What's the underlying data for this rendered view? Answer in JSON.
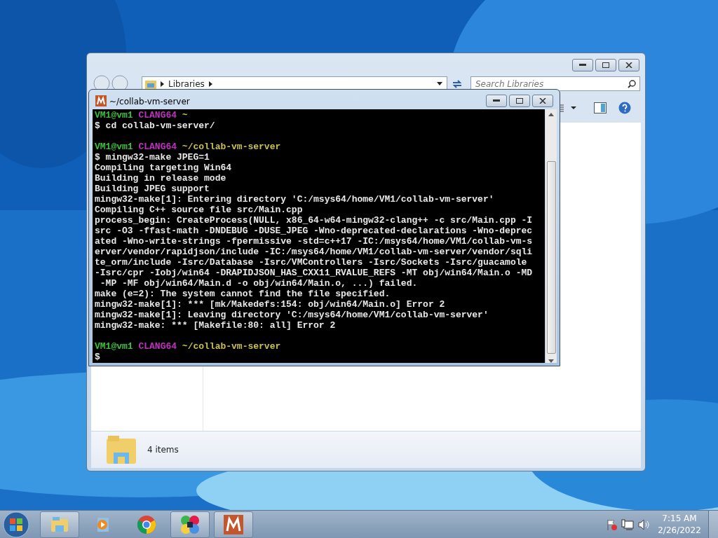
{
  "explorer": {
    "address": [
      "Libraries"
    ],
    "search": {
      "placeholder": "Search Libraries"
    },
    "status": "4 items"
  },
  "terminal": {
    "title": "~/collab-vm-server",
    "lines": [
      {
        "kind": "prompt",
        "user": "VM1@vm1",
        "env": "CLANG64",
        "path": "~"
      },
      {
        "kind": "text",
        "text": "$ cd collab-vm-server/"
      },
      {
        "kind": "blank"
      },
      {
        "kind": "prompt",
        "user": "VM1@vm1",
        "env": "CLANG64",
        "path": "~/collab-vm-server"
      },
      {
        "kind": "text",
        "text": "$ mingw32-make JPEG=1"
      },
      {
        "kind": "text",
        "text": "Compiling targeting Win64"
      },
      {
        "kind": "text",
        "text": "Building in release mode"
      },
      {
        "kind": "text",
        "text": "Building JPEG support"
      },
      {
        "kind": "text",
        "text": "mingw32-make[1]: Entering directory 'C:/msys64/home/VM1/collab-vm-server'"
      },
      {
        "kind": "text",
        "text": "Compiling C++ source file src/Main.cpp"
      },
      {
        "kind": "text",
        "text": "process_begin: CreateProcess(NULL, x86_64-w64-mingw32-clang++ -c src/Main.cpp -I"
      },
      {
        "kind": "text",
        "text": "src -O3 -ffast-math -DNDEBUG -DUSE_JPEG -Wno-deprecated-declarations -Wno-deprec"
      },
      {
        "kind": "text",
        "text": "ated -Wno-write-strings -fpermissive -std=c++17 -IC:/msys64/home/VM1/collab-vm-s"
      },
      {
        "kind": "text",
        "text": "erver/vendor/rapidjson/include -IC:/msys64/home/VM1/collab-vm-server/vendor/sqli"
      },
      {
        "kind": "text",
        "text": "te_orm/include -Isrc/Database -Isrc/VMControllers -Isrc/Sockets -Isrc/guacamole"
      },
      {
        "kind": "text",
        "text": "-Isrc/cpr -Iobj/win64 -DRAPIDJSON_HAS_CXX11_RVALUE_REFS -MT obj/win64/Main.o -MD"
      },
      {
        "kind": "text",
        "text": " -MP -MF obj/win64/Main.d -o obj/win64/Main.o, ...) failed."
      },
      {
        "kind": "text",
        "text": "make (e=2): The system cannot find the file specified."
      },
      {
        "kind": "text",
        "text": "mingw32-make[1]: *** [mk/Makedefs:154: obj/win64/Main.o] Error 2"
      },
      {
        "kind": "text",
        "text": "mingw32-make[1]: Leaving directory 'C:/msys64/home/VM1/collab-vm-server'"
      },
      {
        "kind": "text",
        "text": "mingw32-make: *** [Makefile:80: all] Error 2"
      },
      {
        "kind": "blank"
      },
      {
        "kind": "prompt",
        "user": "VM1@vm1",
        "env": "CLANG64",
        "path": "~/collab-vm-server"
      },
      {
        "kind": "text",
        "text": "$"
      }
    ]
  },
  "taskbar": {
    "items": [
      {
        "kind": "explorer",
        "open": true
      },
      {
        "kind": "media",
        "open": false
      },
      {
        "kind": "chrome",
        "open": false
      },
      {
        "kind": "pinwheel",
        "open": true
      },
      {
        "kind": "msys",
        "open": true
      }
    ],
    "clock": {
      "time": "7:15 AM",
      "date": "2/26/2022"
    }
  }
}
